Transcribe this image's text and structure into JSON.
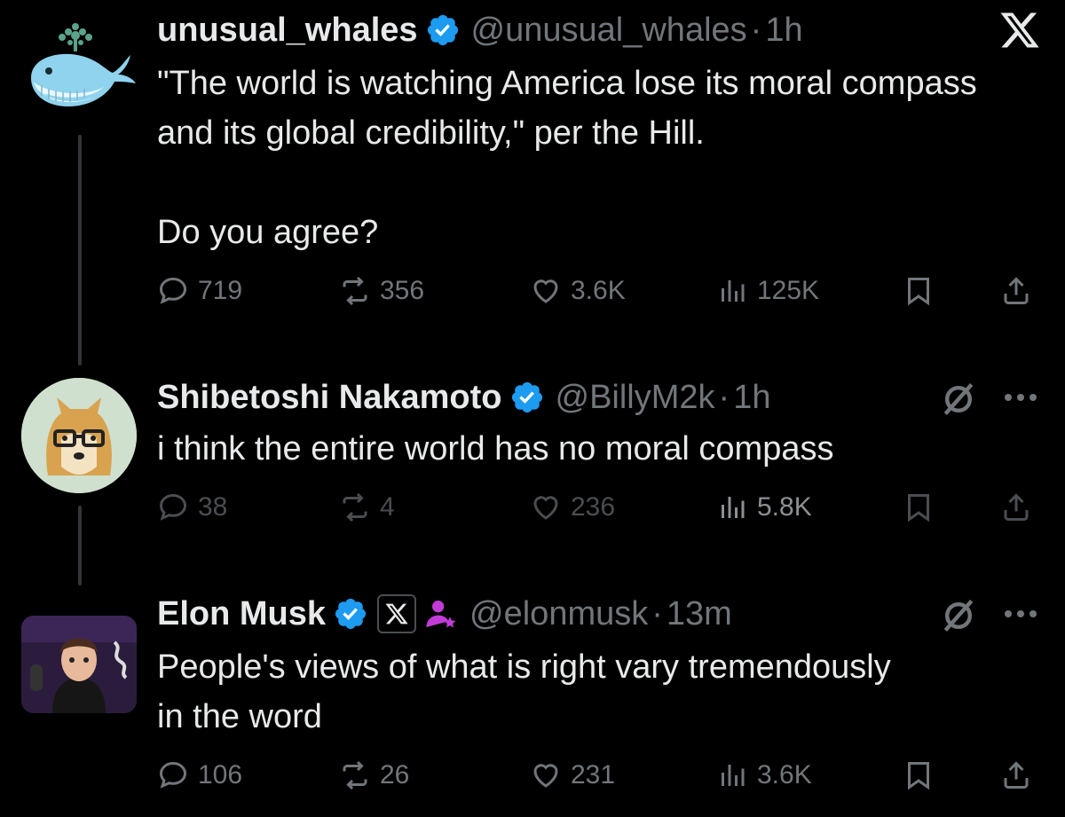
{
  "tweets": [
    {
      "name": "unusual_whales",
      "handle": "@unusual_whales",
      "separator": "·",
      "time": "1h",
      "text": "\"The world is watching America lose its moral compass and its global credibility,\" per the Hill.\n\nDo you agree?",
      "replies": "719",
      "retweets": "356",
      "likes": "3.6K",
      "views": "125K"
    },
    {
      "name": "Shibetoshi Nakamoto",
      "handle": "@BillyM2k",
      "separator": "·",
      "time": "1h",
      "text": "i think the entire world has no moral compass",
      "replies": "38",
      "retweets": "4",
      "likes": "236",
      "views": "5.8K"
    },
    {
      "name": "Elon Musk",
      "handle": "@elonmusk",
      "separator": "·",
      "time": "13m",
      "text": "People's views of what is right vary tremendously\nin the word",
      "replies": "106",
      "retweets": "26",
      "likes": "231",
      "views": "3.6K"
    }
  ],
  "colors": {
    "background": "#000000",
    "text": "#e7e9ea",
    "muted": "#71767b",
    "verified": "#1d9bf0",
    "thread_line": "#333639"
  },
  "icons": [
    "x-logo-icon",
    "verified-badge-icon",
    "reply-icon",
    "retweet-icon",
    "like-icon",
    "views-icon",
    "bookmark-icon",
    "share-icon",
    "grok-icon",
    "more-icon",
    "affiliate-x-badge-icon",
    "subscriber-person-icon"
  ],
  "brand": {
    "logo_text": "X"
  }
}
